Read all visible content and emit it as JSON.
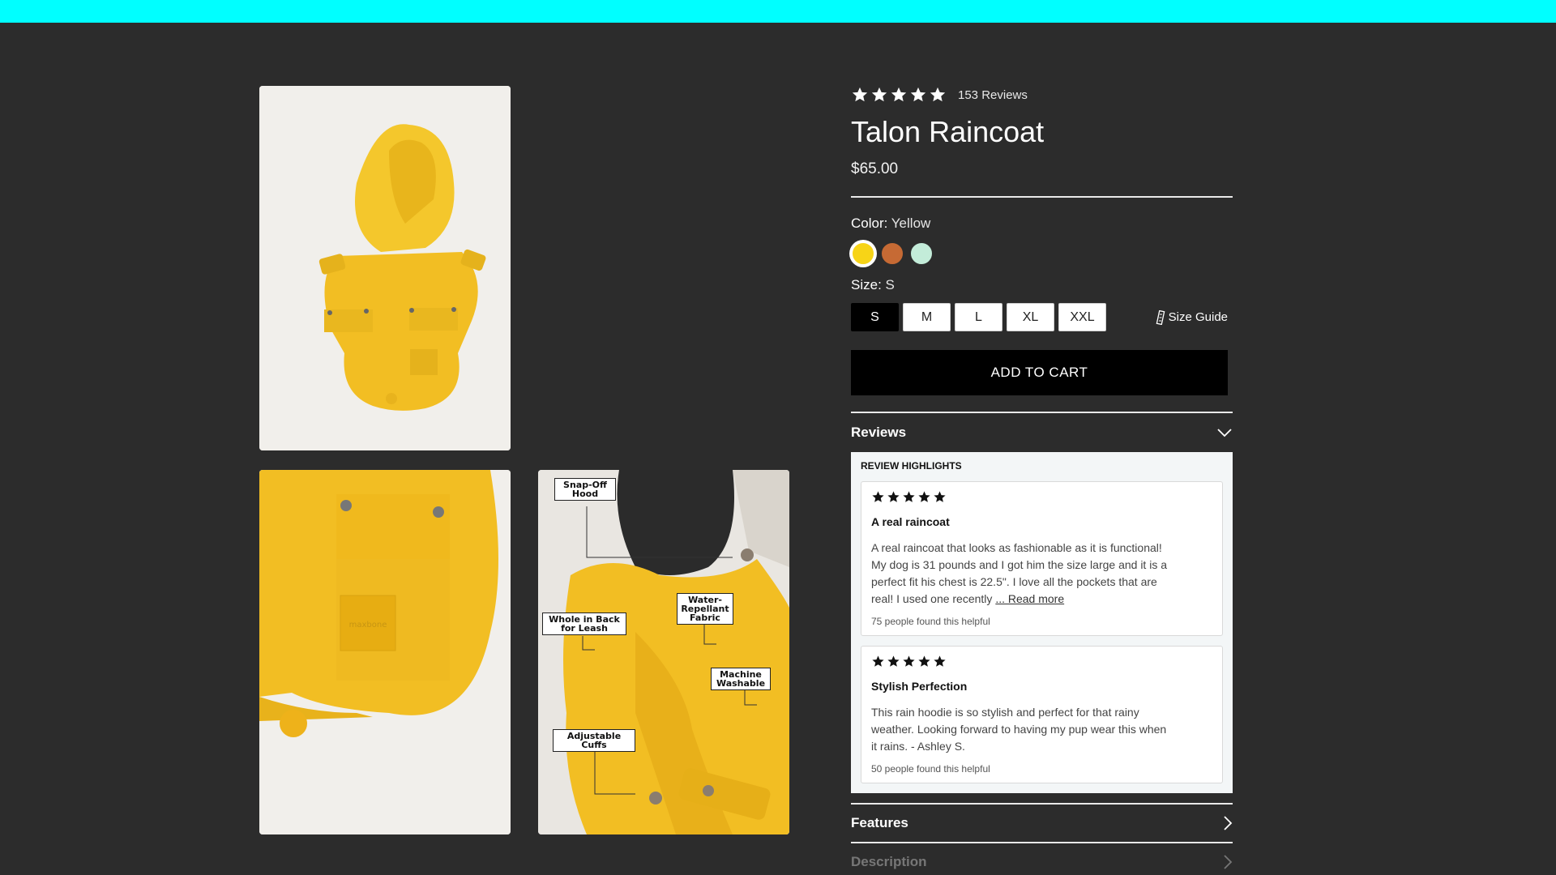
{
  "product": {
    "rating_count": "153 Reviews",
    "stars": 5,
    "title": "Talon Raincoat",
    "price": "$65.00",
    "color_label": "Color:",
    "color_value": "Yellow",
    "colors": [
      {
        "name": "Yellow",
        "hex": "#f7d417",
        "selected": true
      },
      {
        "name": "Rust",
        "hex": "#c66a34",
        "selected": false
      },
      {
        "name": "Mint",
        "hex": "#c3ecd9",
        "selected": false
      }
    ],
    "size_label": "Size:",
    "size_value": "S",
    "sizes": [
      "S",
      "M",
      "L",
      "XL",
      "XXL"
    ],
    "selected_size": "S",
    "size_guide": "Size Guide",
    "add_to_cart": "ADD TO CART"
  },
  "gallery": {
    "callouts": [
      "Snap-Off Hood",
      "Water-Repellant Fabric",
      "Whole in Back for Leash",
      "Machine Washable",
      "Adjustable Cuffs"
    ],
    "patch_text": "maxbone"
  },
  "reviews_section": {
    "title": "Reviews",
    "highlights_title": "REVIEW HIGHLIGHTS",
    "items": [
      {
        "stars": 5,
        "title": "A real raincoat",
        "body": "A real raincoat that looks as fashionable as it is functional! My dog is 31 pounds and I got him the size large and it is a perfect fit his chest is 22.5\". I love all the pockets that are real! I used one recently",
        "more": "... Read more",
        "helpful": "75 people found this helpful"
      },
      {
        "stars": 5,
        "title": "Stylish Perfection",
        "body": "This rain hoodie is so stylish and perfect for that rainy weather. Looking forward to having my pup wear this when it rains. - Ashley S.",
        "helpful": "50 people found this helpful"
      }
    ]
  },
  "features": {
    "title": "Features"
  },
  "description": {
    "title": "Description"
  },
  "colors": {
    "topbar": "#00ffff",
    "background": "#2c2c2c",
    "raincoat": "#f2be23"
  }
}
